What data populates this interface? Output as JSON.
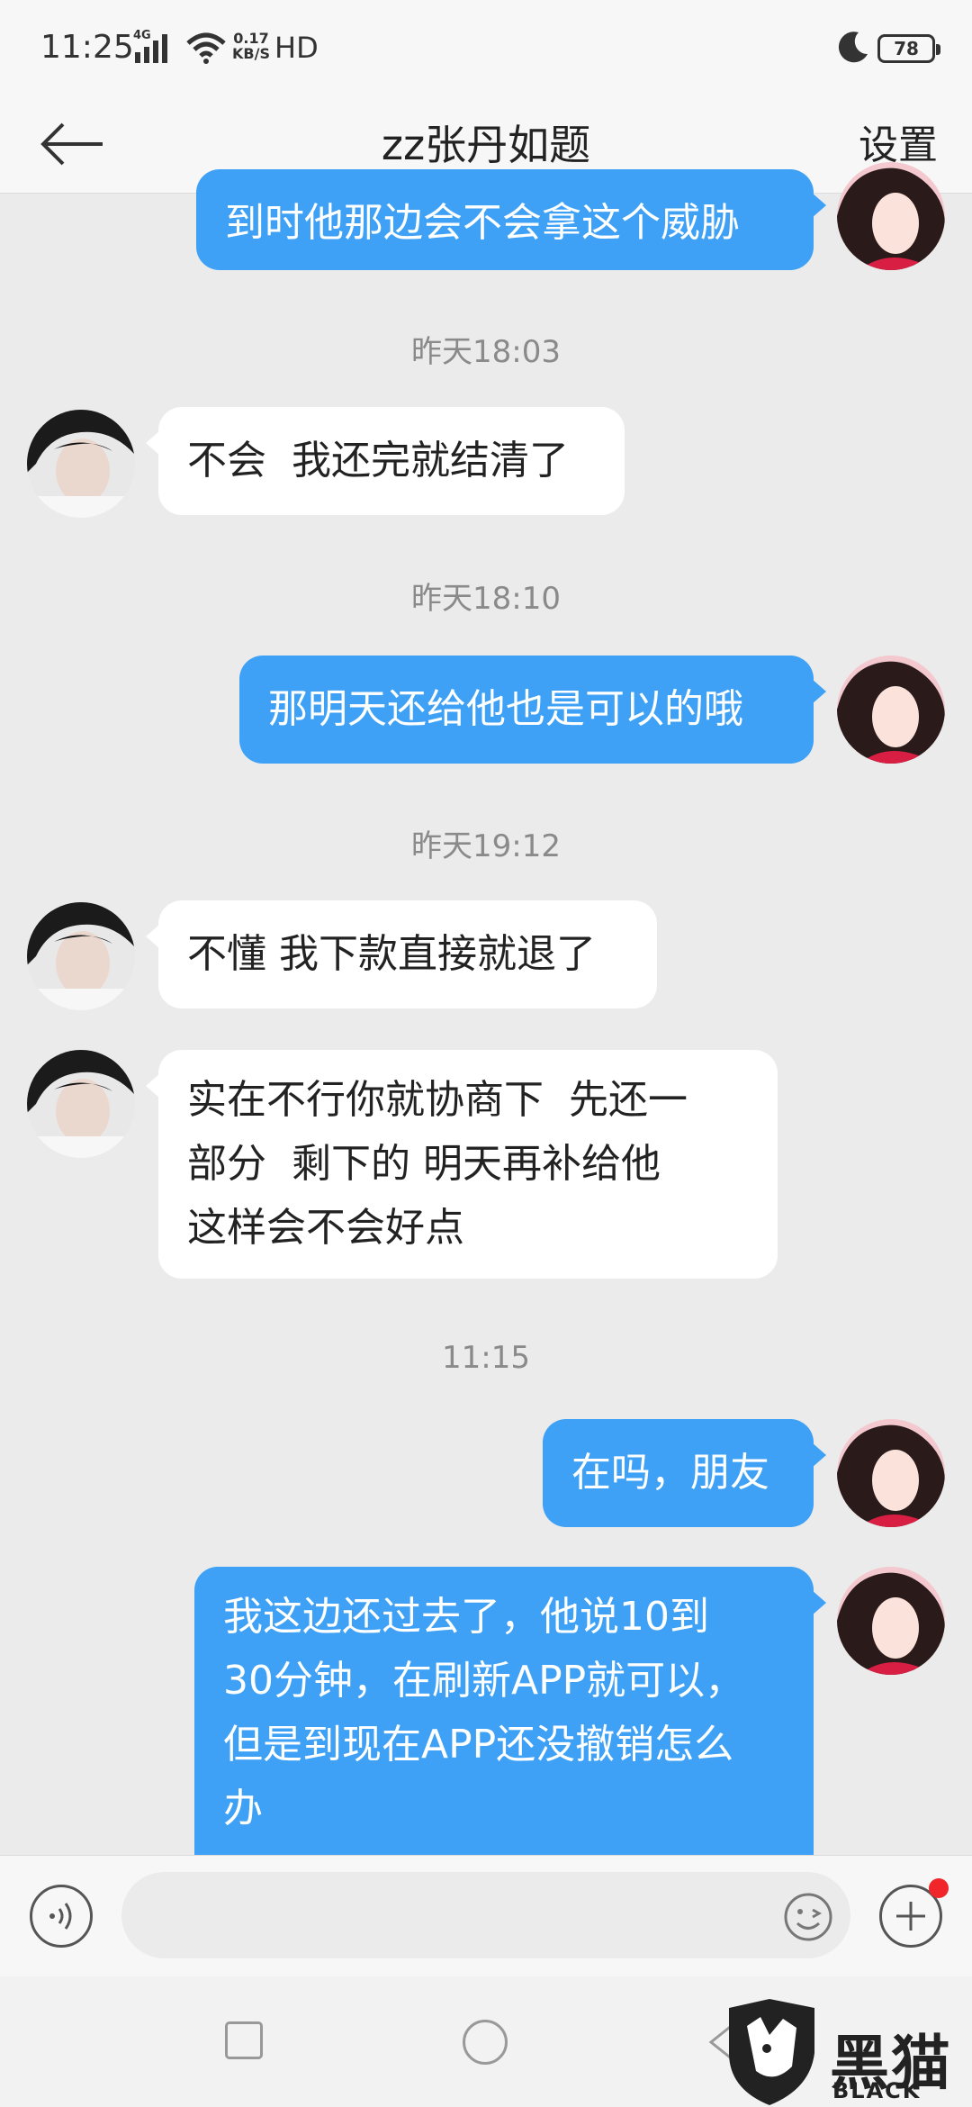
{
  "status_bar": {
    "time": "11:25",
    "network": "4G",
    "speed_value": "0.17",
    "speed_unit": "KB/S",
    "hd": "HD",
    "battery": "78"
  },
  "header": {
    "title": "zz张丹如题",
    "settings_label": "设置"
  },
  "messages": {
    "m0": "到时他那边会不会拿这个威胁",
    "t1": "昨天18:03",
    "m1": "不会  我还完就结清了",
    "t2": "昨天18:10",
    "m2": "那明天还给他也是可以的哦",
    "t3": "昨天19:12",
    "m3": "不懂 我下款直接就退了",
    "m4": "实在不行你就协商下  先还一\n部分  剩下的 明天再补给他\n这样会不会好点",
    "t4": "11:15",
    "m5": "在吗，朋友",
    "m6": "我这边还过去了，他说10到\n30分钟，在刷新APP就可以，\n但是到现在APP还没撤销怎么\n办"
  },
  "input": {
    "value": ""
  },
  "watermark": {
    "text": "黑猫",
    "sub": "BLACK CAT"
  },
  "colors": {
    "sent_bubble": "#3ea1f6",
    "received_bubble": "#ffffff",
    "background": "#ebebeb",
    "notification_dot": "#f0262a"
  }
}
